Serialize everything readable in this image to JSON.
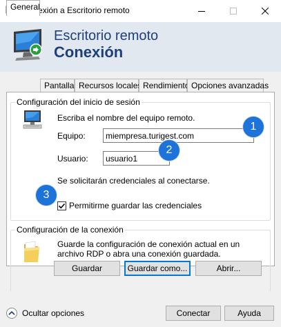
{
  "window": {
    "title": "Conexión a Escritorio remoto",
    "minimize_icon": "minimize-icon",
    "maximize_icon": "maximize-icon",
    "close_icon": "close-icon"
  },
  "banner": {
    "line1": "Escritorio remoto",
    "line2": "Conexión",
    "text_color": "#1f3f7a",
    "background": "#e1e8f0"
  },
  "tabs": [
    {
      "label": "General",
      "active": true
    },
    {
      "label": "Pantalla",
      "active": false
    },
    {
      "label": "Recursos locales",
      "active": false
    },
    {
      "label": "Rendimiento",
      "active": false
    },
    {
      "label": "Opciones avanzadas",
      "active": false
    }
  ],
  "login_group": {
    "legend": "Configuración del inicio de sesión",
    "instruction": "Escriba el nombre del equipo remoto.",
    "computer_label": "Equipo:",
    "computer_value": "miempresa.turigest.com",
    "user_label": "Usuario:",
    "user_value": "usuario1",
    "credentials_note": "Se solicitarán credenciales al conectarse.",
    "save_credentials_label": "Permitirme guardar las credenciales",
    "save_credentials_checked": true
  },
  "badges": [
    "1",
    "2",
    "3"
  ],
  "badge_color": "#1e73d8",
  "connection_group": {
    "legend": "Configuración de la conexión",
    "description": "Guarde la configuración de conexión actual en un archivo RDP o abra una conexión guardada.",
    "save_button": "Guardar",
    "save_as_button": "Guardar como...",
    "open_button": "Abrir..."
  },
  "footer": {
    "hide_options": "Ocultar opciones",
    "connect_button": "Conectar",
    "help_button": "Ayuda"
  }
}
